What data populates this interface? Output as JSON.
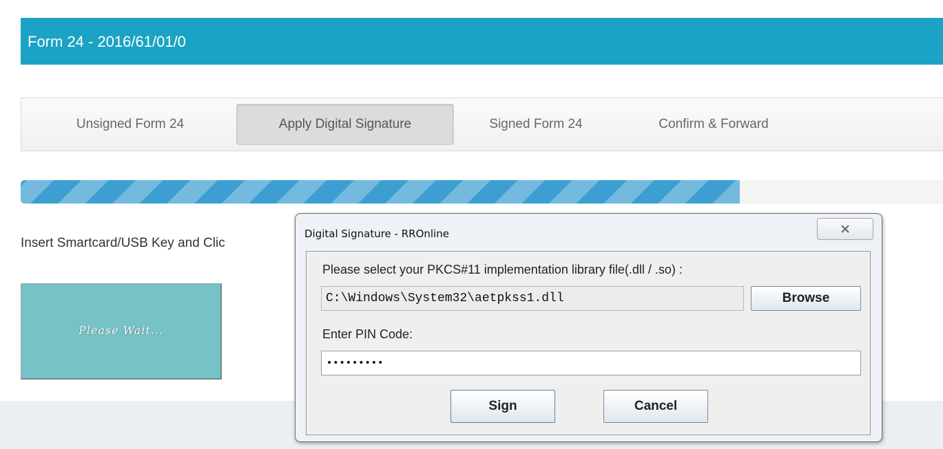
{
  "header": {
    "title": "Form 24 - 2016/61/01/0",
    "color": "#1aa3c4"
  },
  "tabs": [
    {
      "label": "Unsigned Form 24",
      "active": false
    },
    {
      "label": "Apply Digital Signature",
      "active": true
    },
    {
      "label": "Signed Form 24",
      "active": false
    },
    {
      "label": "Confirm & Forward",
      "active": false
    }
  ],
  "progress": {
    "fraction": 0.78,
    "color": "#3d9fd1"
  },
  "instruction": "Insert Smartcard/USB Key and Clic",
  "wait_button": {
    "label": "Please Wait...",
    "color": "#76c2c6"
  },
  "dialog": {
    "title": "Digital Signature - RROnline",
    "close_icon": "close-x-icon",
    "library_prompt": "Please select your PKCS#11 implementation library file(.dll / .so) :",
    "library_path": "C:\\Windows\\System32\\aetpkss1.dll",
    "browse_label": "Browse",
    "pin_label": "Enter PIN Code:",
    "pin_value": "•••••••••",
    "sign_label": "Sign",
    "cancel_label": "Cancel"
  }
}
